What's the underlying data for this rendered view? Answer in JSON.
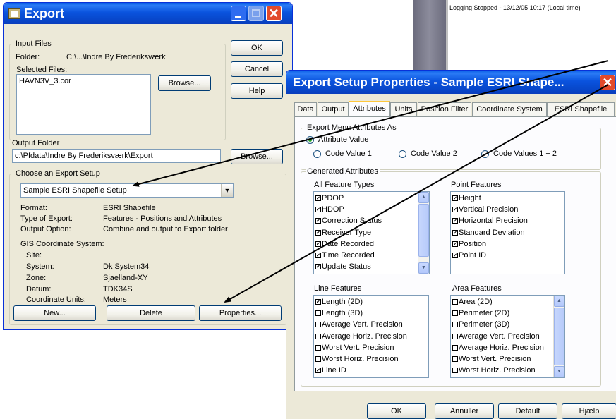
{
  "log_window": {
    "status_text": "Logging Stopped - 13/12/05 10:17 (Local time)"
  },
  "export_dialog": {
    "title": "Export",
    "input_files_group": "Input Files",
    "folder_label": "Folder:",
    "folder_value": "C:\\...\\Indre By Frederiksværk",
    "selected_files_label": "Selected Files:",
    "selected_files": [
      "HAVN3V_3.cor"
    ],
    "browse_label": "Browse...",
    "output_folder_label": "Output Folder",
    "output_folder_value": "c:\\Pfdata\\Indre By Frederiksværk\\Export",
    "output_browse_label": "Browse...",
    "ok_label": "OK",
    "cancel_label": "Cancel",
    "help_label": "Help",
    "choose_setup_group": "Choose an Export Setup",
    "setup_selected": "Sample ESRI Shapefile Setup",
    "details": {
      "format_label": "Format:",
      "format_value": "ESRI Shapefile",
      "type_label": "Type of Export:",
      "type_value": "Features - Positions and Attributes",
      "output_option_label": "Output Option:",
      "output_option_value": "Combine and output to Export folder",
      "gis_label": "GIS Coordinate System:",
      "site_label": "Site:",
      "site_value": "",
      "system_label": "System:",
      "system_value": "Dk System34",
      "zone_label": "Zone:",
      "zone_value": "Sjaelland-XY",
      "datum_label": "Datum:",
      "datum_value": "TDK34S",
      "units_label": "Coordinate Units:",
      "units_value": "Meters"
    },
    "new_label": "New...",
    "delete_label": "Delete",
    "properties_label": "Properties...",
    "title_button_colors": {
      "minmax": "#2e6cf0",
      "close": "#e24a2b"
    }
  },
  "props_dialog": {
    "title": "Export Setup Properties - Sample ESRI Shape...",
    "tabs": [
      "Data",
      "Output",
      "Attributes",
      "Units",
      "Position Filter",
      "Coordinate System",
      "ESRI Shapefile"
    ],
    "active_tab": "Attributes",
    "menu_attrs_group": "Export Menu Attributes As",
    "radio_options": [
      {
        "label": "Attribute Value",
        "selected": true
      },
      {
        "label": "Code Value 1",
        "selected": false
      },
      {
        "label": "Code Value 2",
        "selected": false
      },
      {
        "label": "Code Values 1 + 2",
        "selected": false
      }
    ],
    "generated_group": "Generated Attributes",
    "all_features": {
      "label": "All Feature Types",
      "items": [
        {
          "label": "PDOP",
          "checked": true
        },
        {
          "label": "HDOP",
          "checked": true
        },
        {
          "label": "Correction Status",
          "checked": true
        },
        {
          "label": "Receiver Type",
          "checked": true
        },
        {
          "label": "Date Recorded",
          "checked": true
        },
        {
          "label": "Time Recorded",
          "checked": true
        },
        {
          "label": "Update Status",
          "checked": true
        }
      ]
    },
    "point_features": {
      "label": "Point Features",
      "items": [
        {
          "label": "Height",
          "checked": true
        },
        {
          "label": "Vertical Precision",
          "checked": true
        },
        {
          "label": "Horizontal Precision",
          "checked": true
        },
        {
          "label": "Standard Deviation",
          "checked": true
        },
        {
          "label": "Position",
          "checked": true
        },
        {
          "label": "Point ID",
          "checked": true
        }
      ]
    },
    "line_features": {
      "label": "Line Features",
      "items": [
        {
          "label": "Length (2D)",
          "checked": true
        },
        {
          "label": "Length (3D)",
          "checked": false
        },
        {
          "label": "Average Vert. Precision",
          "checked": false
        },
        {
          "label": "Average Horiz. Precision",
          "checked": false
        },
        {
          "label": "Worst Vert. Precision",
          "checked": false
        },
        {
          "label": "Worst Horiz. Precision",
          "checked": false
        },
        {
          "label": "Line ID",
          "checked": true
        }
      ]
    },
    "area_features": {
      "label": "Area Features",
      "items": [
        {
          "label": "Area (2D)",
          "checked": false
        },
        {
          "label": "Perimeter (2D)",
          "checked": false
        },
        {
          "label": "Perimeter (3D)",
          "checked": false
        },
        {
          "label": "Average Vert. Precision",
          "checked": false
        },
        {
          "label": "Average Horiz. Precision",
          "checked": false
        },
        {
          "label": "Worst Vert. Precision",
          "checked": false
        },
        {
          "label": "Worst Horiz. Precision",
          "checked": false
        }
      ]
    },
    "ok_label": "OK",
    "cancel_label": "Annuller",
    "default_label": "Default",
    "help_label": "Hjælp"
  }
}
